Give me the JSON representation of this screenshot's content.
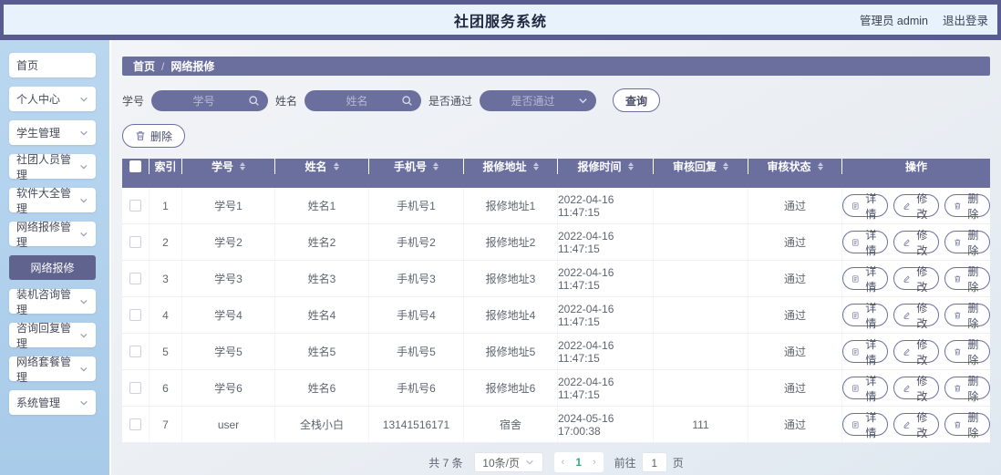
{
  "header": {
    "title": "社团服务系统",
    "user": "管理员 admin",
    "logout": "退出登录"
  },
  "sidebar": {
    "items": [
      {
        "label": "首页",
        "chevron": false,
        "active": false
      },
      {
        "label": "个人中心",
        "chevron": true,
        "active": false
      },
      {
        "label": "学生管理",
        "chevron": true,
        "active": false
      },
      {
        "label": "社团人员管理",
        "chevron": true,
        "active": false
      },
      {
        "label": "软件大全管理",
        "chevron": true,
        "active": false
      },
      {
        "label": "网络报修管理",
        "chevron": true,
        "active": false
      },
      {
        "label": "网络报修",
        "chevron": false,
        "active": true
      },
      {
        "label": "装机咨询管理",
        "chevron": true,
        "active": false
      },
      {
        "label": "咨询回复管理",
        "chevron": true,
        "active": false
      },
      {
        "label": "网络套餐管理",
        "chevron": true,
        "active": false
      },
      {
        "label": "系统管理",
        "chevron": true,
        "active": false
      }
    ]
  },
  "breadcrumb": {
    "home": "首页",
    "separator": "/",
    "current": "网络报修"
  },
  "filters": {
    "student_id_label": "学号",
    "student_id_placeholder": "学号",
    "name_label": "姓名",
    "name_placeholder": "姓名",
    "passed_label": "是否通过",
    "passed_placeholder": "是否通过",
    "search_label": "查询"
  },
  "toolbar": {
    "delete_label": "删除"
  },
  "table": {
    "columns": [
      {
        "key": "checkbox",
        "label": "",
        "type": "checkbox",
        "sortable": false
      },
      {
        "key": "index",
        "label": "索引",
        "sortable": false
      },
      {
        "key": "student_id",
        "label": "学号",
        "sortable": true
      },
      {
        "key": "name",
        "label": "姓名",
        "sortable": true
      },
      {
        "key": "phone",
        "label": "手机号",
        "sortable": true
      },
      {
        "key": "address",
        "label": "报修地址",
        "sortable": true
      },
      {
        "key": "time",
        "label": "报修时间",
        "sortable": true
      },
      {
        "key": "reply",
        "label": "审核回复",
        "sortable": true
      },
      {
        "key": "status",
        "label": "审核状态",
        "sortable": true
      },
      {
        "key": "actions",
        "label": "操作",
        "type": "actions",
        "sortable": false
      }
    ],
    "rows": [
      {
        "index": "1",
        "student_id": "学号1",
        "name": "姓名1",
        "phone": "手机号1",
        "address": "报修地址1",
        "time": "2022-04-16 11:47:15",
        "reply": "",
        "status": "通过"
      },
      {
        "index": "2",
        "student_id": "学号2",
        "name": "姓名2",
        "phone": "手机号2",
        "address": "报修地址2",
        "time": "2022-04-16 11:47:15",
        "reply": "",
        "status": "通过"
      },
      {
        "index": "3",
        "student_id": "学号3",
        "name": "姓名3",
        "phone": "手机号3",
        "address": "报修地址3",
        "time": "2022-04-16 11:47:15",
        "reply": "",
        "status": "通过"
      },
      {
        "index": "4",
        "student_id": "学号4",
        "name": "姓名4",
        "phone": "手机号4",
        "address": "报修地址4",
        "time": "2022-04-16 11:47:15",
        "reply": "",
        "status": "通过"
      },
      {
        "index": "5",
        "student_id": "学号5",
        "name": "姓名5",
        "phone": "手机号5",
        "address": "报修地址5",
        "time": "2022-04-16 11:47:15",
        "reply": "",
        "status": "通过"
      },
      {
        "index": "6",
        "student_id": "学号6",
        "name": "姓名6",
        "phone": "手机号6",
        "address": "报修地址6",
        "time": "2022-04-16 11:47:15",
        "reply": "",
        "status": "通过"
      },
      {
        "index": "7",
        "student_id": "user",
        "name": "全栈小白",
        "phone": "13141516171",
        "address": "宿舍",
        "time": "2024-05-16 17:00:38",
        "reply": "111",
        "status": "通过"
      }
    ],
    "actions": {
      "detail": "详情",
      "edit": "修改",
      "delete": "删除"
    }
  },
  "pagination": {
    "total": "共 7 条",
    "page_size": "10条/页",
    "prev": "‹",
    "current_page": "1",
    "next": "›",
    "goto_label": "前往",
    "goto_value": "1",
    "page_label": "页"
  },
  "colors": {
    "primary_purple": "#6b6f9e",
    "frame_purple": "#585c8f",
    "active_item": "#5f638e",
    "header_bg": "#e7f2fc",
    "sidebar_bg": "#aecdea",
    "pager_active": "#3ca886"
  }
}
